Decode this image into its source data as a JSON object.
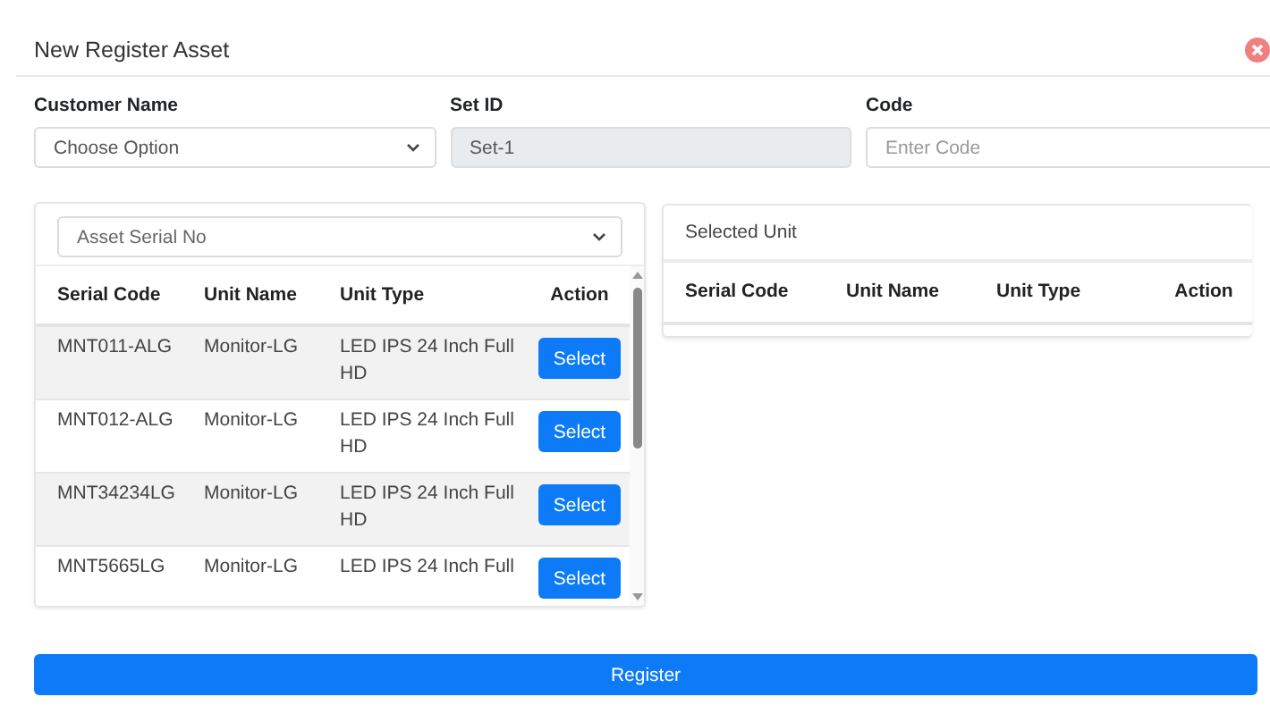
{
  "modal": {
    "title": "New Register Asset"
  },
  "fields": [
    {
      "kind": "select",
      "label": "Customer Name",
      "value": "Choose Option"
    },
    {
      "kind": "readonly",
      "label": "Set ID",
      "value": "Set-1"
    },
    {
      "kind": "input",
      "label": "Code",
      "placeholder": "Enter Code"
    }
  ],
  "asset_panel": {
    "select": {
      "value": "Asset Serial No"
    },
    "table": {
      "columns": [
        "Serial Code",
        "Unit Name",
        "Unit Type",
        "Action"
      ],
      "rows": [
        {
          "serial_code": "MNT011-ALG",
          "unit_name": "Monitor-LG",
          "unit_type": "LED IPS 24 Inch Full HD",
          "action": "Select"
        },
        {
          "serial_code": "MNT012-ALG",
          "unit_name": "Monitor-LG",
          "unit_type": "LED IPS 24 Inch Full HD",
          "action": "Select"
        },
        {
          "serial_code": "MNT34234LG",
          "unit_name": "Monitor-LG",
          "unit_type": "LED IPS 24 Inch Full HD",
          "action": "Select"
        },
        {
          "serial_code": "MNT5665LG",
          "unit_name": "Monitor-LG",
          "unit_type": "LED IPS 24 Inch Full",
          "action": "Select"
        }
      ]
    }
  },
  "selected_panel": {
    "title": "Selected Unit",
    "columns": [
      "Serial Code",
      "Unit Name",
      "Unit Type",
      "Action"
    ]
  },
  "register_button": "Register"
}
